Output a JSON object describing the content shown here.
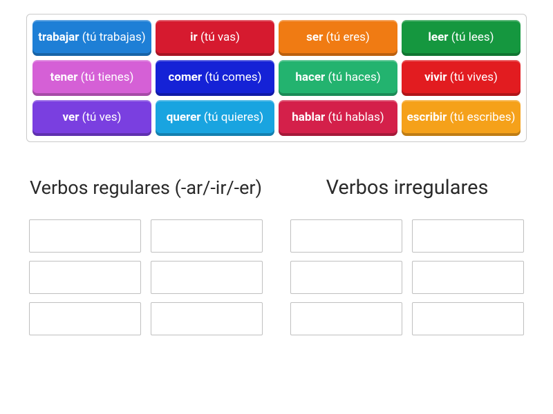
{
  "tiles": [
    {
      "verb": "trabajar",
      "conj": "(tú trabajas)",
      "color": "#1e7fd6"
    },
    {
      "verb": "ir",
      "conj": "(tú vas)",
      "color": "#d61a2f"
    },
    {
      "verb": "ser",
      "conj": "(tú eres)",
      "color": "#f07b13"
    },
    {
      "verb": "leer",
      "conj": "(tú lees)",
      "color": "#15973f"
    },
    {
      "verb": "tener",
      "conj": "(tú tienes)",
      "color": "#d560d6"
    },
    {
      "verb": "comer",
      "conj": "(tú comes)",
      "color": "#1522d6"
    },
    {
      "verb": "hacer",
      "conj": "(tú haces)",
      "color": "#23b36f"
    },
    {
      "verb": "vivir",
      "conj": "(tú vives)",
      "color": "#e21c20"
    },
    {
      "verb": "ver",
      "conj": "(tú ves)",
      "color": "#7a3fe0"
    },
    {
      "verb": "querer",
      "conj": "(tú quieres)",
      "color": "#19a4e0"
    },
    {
      "verb": "hablar",
      "conj": "(tú hablas)",
      "color": "#d4204a"
    },
    {
      "verb": "escribir",
      "conj": "(tú escribes)",
      "color": "#f5a11a"
    }
  ],
  "categories": [
    {
      "title": "Verbos regulares (-ar/-ir/-er)",
      "slots": 6
    },
    {
      "title": "Verbos irregulares",
      "slots": 6
    }
  ]
}
